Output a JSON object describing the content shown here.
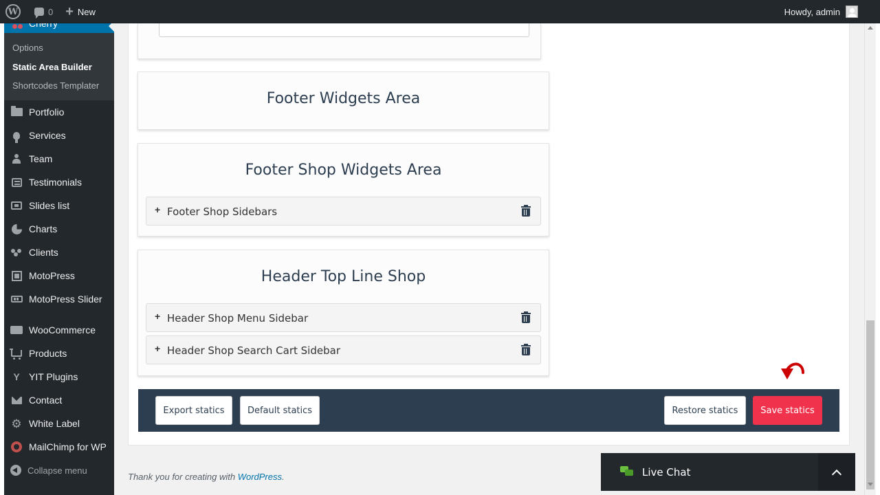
{
  "admin_bar": {
    "comments_count": "0",
    "new_label": "New",
    "greeting": "Howdy, admin"
  },
  "sidebar": {
    "active_menu": "Cherry",
    "submenu": [
      "Options",
      "Static Area Builder",
      "Shortcodes Templater"
    ],
    "items": [
      {
        "label": "Portfolio",
        "icon": "folder-icon"
      },
      {
        "label": "Services",
        "icon": "lightbulb-icon"
      },
      {
        "label": "Team",
        "icon": "person-icon"
      },
      {
        "label": "Testimonials",
        "icon": "testimonial-icon"
      },
      {
        "label": "Slides list",
        "icon": "slides-icon"
      },
      {
        "label": "Charts",
        "icon": "pie-chart-icon"
      },
      {
        "label": "Clients",
        "icon": "clients-icon"
      },
      {
        "label": "MotoPress",
        "icon": "motopress-icon"
      },
      {
        "label": "MotoPress Slider",
        "icon": "slider-icon"
      },
      {
        "label": "WooCommerce",
        "icon": "woocommerce-icon"
      },
      {
        "label": "Products",
        "icon": "cart-icon"
      },
      {
        "label": "YIT Plugins",
        "icon": "yit-icon"
      },
      {
        "label": "Contact",
        "icon": "mail-icon"
      },
      {
        "label": "White Label",
        "icon": "gear-icon"
      },
      {
        "label": "MailChimp for WP",
        "icon": "mailchimp-icon"
      }
    ],
    "collapse_label": "Collapse menu"
  },
  "areas": [
    {
      "title": "Footer Widgets Area",
      "widgets": []
    },
    {
      "title": "Footer Shop Widgets Area",
      "widgets": [
        "Footer Shop Sidebars"
      ]
    },
    {
      "title": "Header Top Line Shop",
      "widgets": [
        "Header Shop Menu Sidebar",
        "Header Shop Search Cart Sidebar"
      ]
    }
  ],
  "actions": {
    "export": "Export statics",
    "default": "Default statics",
    "restore": "Restore statics",
    "save": "Save statics"
  },
  "footer": {
    "text": "Thank you for creating with ",
    "link": "WordPress",
    "suffix": "."
  },
  "live_chat": {
    "label": "Live Chat"
  },
  "colors": {
    "admin_bar": "#23282d",
    "active_menu": "#0073aa",
    "area_title": "#2d3e50",
    "save_button": "#f1324d",
    "action_bar": "#2d3e50"
  }
}
